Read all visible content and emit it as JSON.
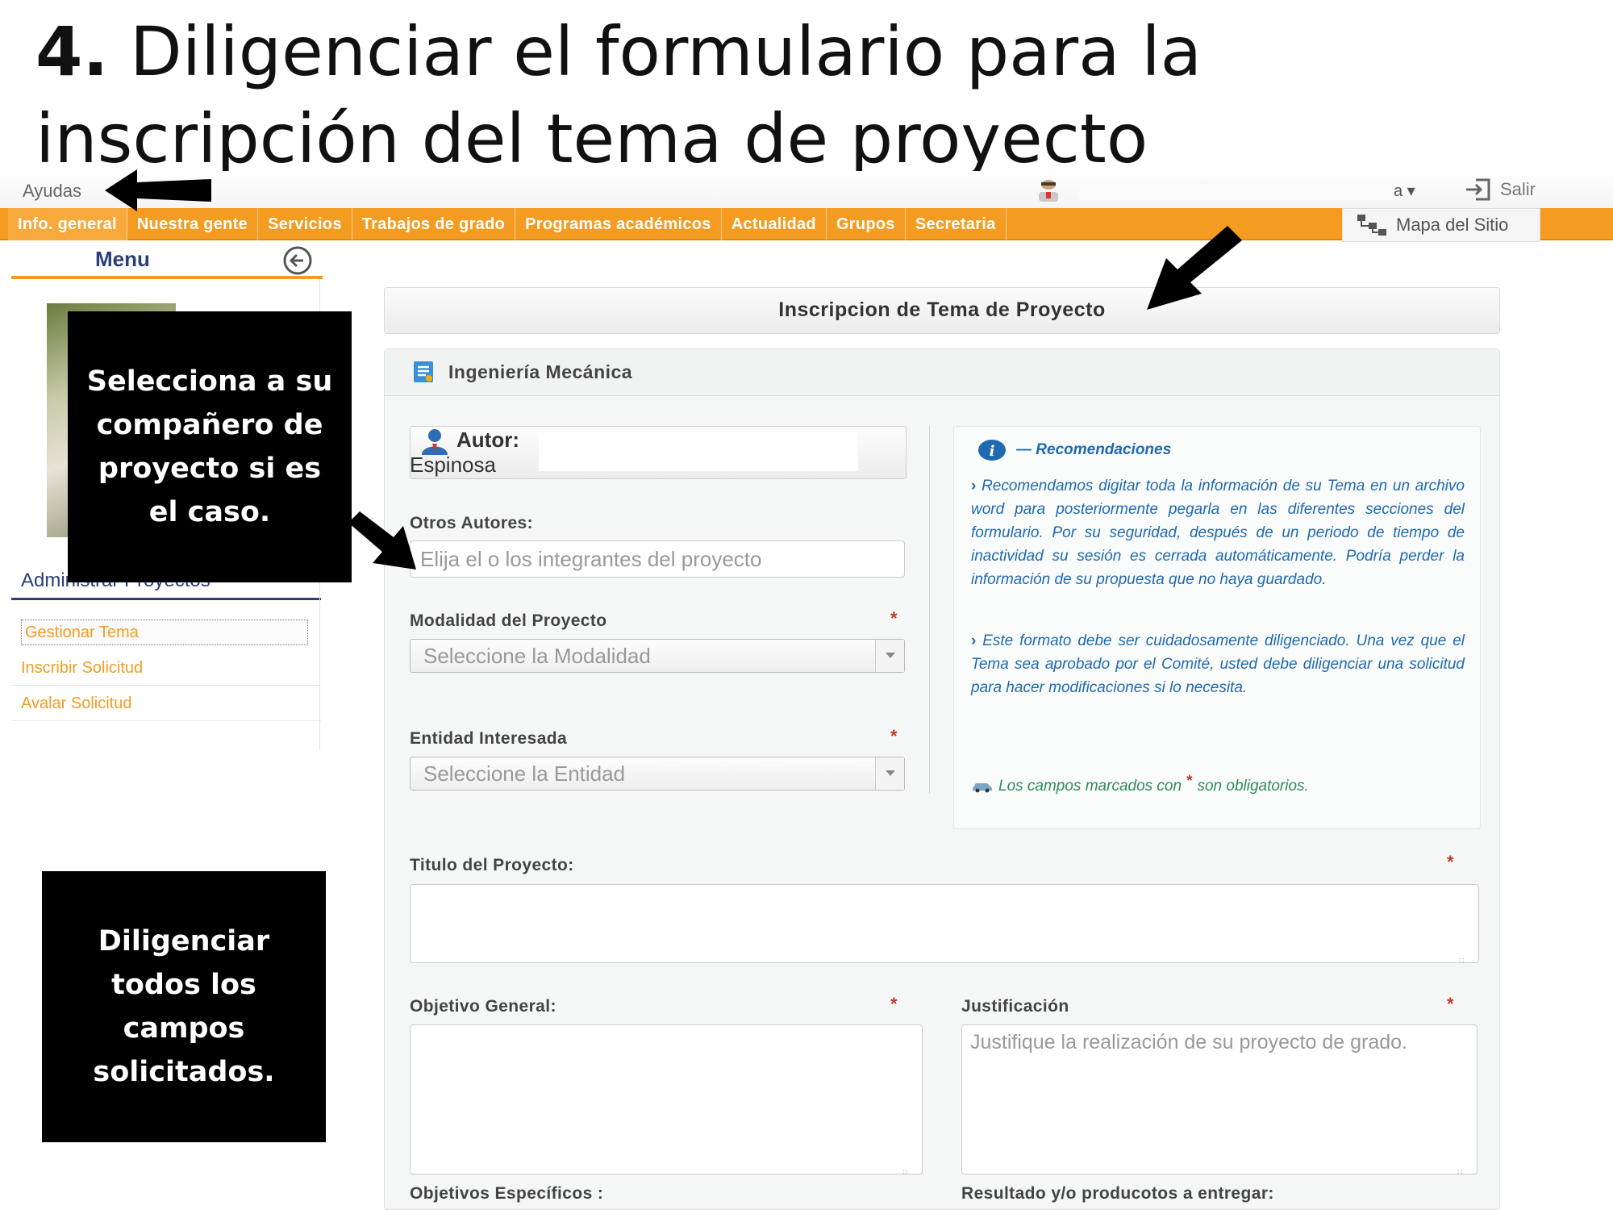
{
  "slide": {
    "step_number": "4.",
    "title_rest": " Diligenciar el formulario para la inscripción del tema de proyecto"
  },
  "topbar": {
    "help_label": "Ayudas",
    "user_caret": "a ▾",
    "logout_label": "Salir"
  },
  "nav": {
    "items": [
      "Info. general",
      "Nuestra gente",
      "Servicios",
      "Trabajos de grado",
      "Programas académicos",
      "Actualidad",
      "Grupos",
      "Secretaria"
    ],
    "sitemap_label": "Mapa del Sitio",
    "active_color": "#f39c21"
  },
  "sidebar": {
    "title": "Menu",
    "section_label": "Administrar Proyectos",
    "items": [
      "Gestionar Tema",
      "Inscribir Solicitud",
      "Avalar Solicitud"
    ]
  },
  "form": {
    "panel_title": "Inscripcion de Tema de Proyecto",
    "program": "Ingeniería Mecánica",
    "author_label": "Autor:",
    "author_name": "Espinosa",
    "other_authors_label": "Otros Autores:",
    "other_authors_placeholder": "Elija el o los integrantes del proyecto",
    "modality_label": "Modalidad del Proyecto",
    "modality_value": "Seleccione la Modalidad",
    "entity_label": "Entidad Interesada",
    "entity_value": "Seleccione la Entidad",
    "required_mark": "*",
    "project_title_label": "Titulo del Proyecto:",
    "general_objective_label": "Objetivo General:",
    "justification_label": "Justificación",
    "justification_placeholder": "Justifique la realización de su proyecto de grado.",
    "specific_objectives_label": "Objetivos Específicos :",
    "results_label": "Resultado y/o producotos a entregar:"
  },
  "recommendations": {
    "title": "— Recomendaciones",
    "p1": "Recomendamos digitar toda la información de su Tema en un archivo word para posteriormente pegarla en las diferentes secciones del formulario. Por su seguridad, después de un periodo de tiempo de inactividad su sesión es cerrada automáticamente. Podría perder la información de su propuesta que no haya guardado.",
    "p2": "Este formato debe ser cuidadosamente diligenciado. Una vez que el Tema sea aprobado por el Comité, usted debe diligenciar una solicitud para hacer modificaciones si lo necesita.",
    "note_before": "Los campos marcados con ",
    "note_star": "*",
    "note_after": " son obligatorios."
  },
  "callouts": {
    "partner": "Selecciona  a su compañero de proyecto si es el caso.",
    "fill": "Diligenciar todos los campos solicitados."
  }
}
